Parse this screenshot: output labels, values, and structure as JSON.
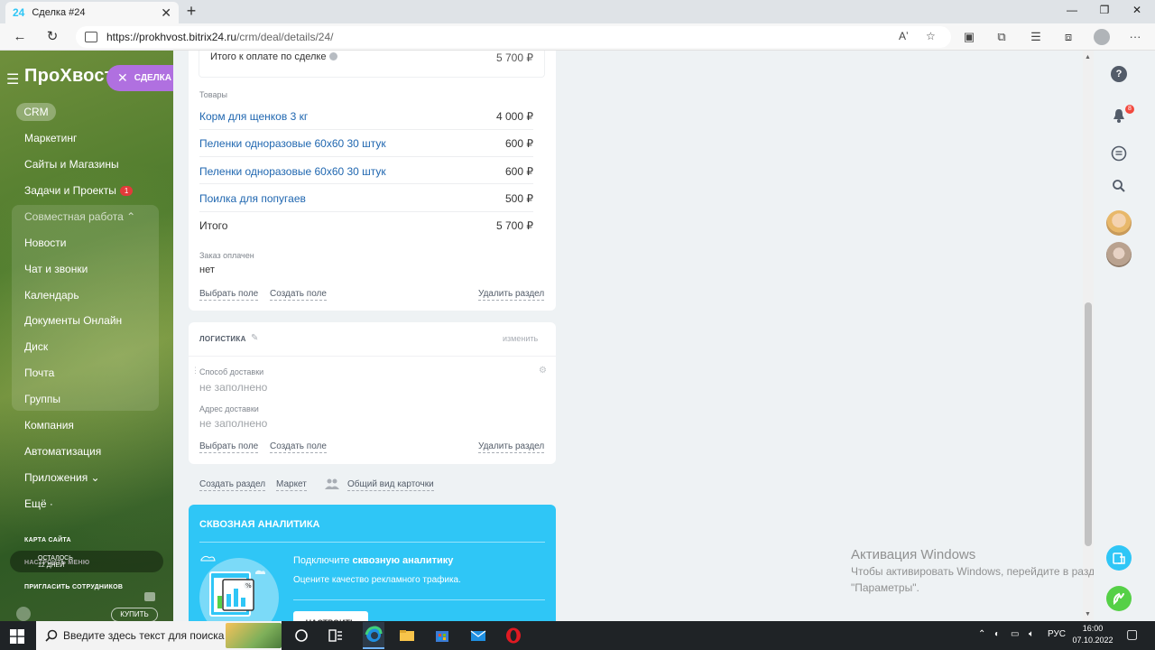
{
  "browser": {
    "tab_favicon": "24",
    "tab_title": "Сделка #24",
    "tab_close": "✕",
    "new_tab": "+",
    "url_host": "https://prokhvost.bitrix24.ru",
    "url_path": "/crm/deal/details/24/",
    "read_aloud": "Aʼ"
  },
  "sidebar": {
    "brand": "ПроХвост",
    "deal_pill": "СДЕЛКА",
    "crm": "CRM",
    "items": [
      {
        "label": "Маркетинг"
      },
      {
        "label": "Сайты и Магазины"
      },
      {
        "label": "Задачи и Проекты",
        "badge": "1"
      },
      {
        "label": "Совместная работа ⌃"
      },
      {
        "label": "Новости"
      },
      {
        "label": "Чат и звонки"
      },
      {
        "label": "Календарь"
      },
      {
        "label": "Документы Онлайн"
      },
      {
        "label": "Диск"
      },
      {
        "label": "Почта"
      },
      {
        "label": "Группы"
      },
      {
        "label": "Компания"
      },
      {
        "label": "Автоматизация"
      },
      {
        "label": "Приложения ⌄"
      },
      {
        "label": "Ещё ·"
      }
    ],
    "sitemap": "КАРТА САЙТА",
    "setup_menu": "НАСТРОИТЬ МЕНЮ",
    "invite": "ПРИГЛАСИТЬ СОТРУДНИКОВ",
    "trial_line1": "ОСТАЛОСЬ",
    "trial_line2": "12 ДНЕЙ",
    "buy": "КУПИТЬ"
  },
  "deal": {
    "total_label": "Итого к оплате по сделке",
    "total_value": "5 700 ₽",
    "goods_label": "Товары",
    "products": [
      {
        "name": "Корм для щенков 3 кг",
        "price": "4 000 ₽"
      },
      {
        "name": "Пеленки одноразовые 60х60 30 штук",
        "price": "600 ₽"
      },
      {
        "name": "Пеленки одноразовые 60х60 30 штук",
        "price": "600 ₽"
      },
      {
        "name": "Поилка для попугаев",
        "price": "500 ₽"
      }
    ],
    "sum_label": "Итого",
    "sum_value": "5 700 ₽",
    "paid_label": "Заказ оплачен",
    "paid_value": "нет",
    "choose_field": "Выбрать поле",
    "create_field": "Создать поле",
    "delete_section": "Удалить раздел"
  },
  "logistics": {
    "title": "ЛОГИСТИКА",
    "edit": "изменить",
    "delivery_label": "Способ доставки",
    "delivery_value": "не заполнено",
    "address_label": "Адрес доставки",
    "address_value": "не заполнено",
    "choose_field": "Выбрать поле",
    "create_field": "Создать поле",
    "delete_section": "Удалить раздел"
  },
  "bottom_links": {
    "create_section": "Создать раздел",
    "market": "Маркет",
    "common_view": "Общий вид карточки"
  },
  "analytics": {
    "title": "СКВОЗНАЯ АНАЛИТИКА",
    "line1_prefix": "Подключите ",
    "line1_bold": "сквозную аналитику",
    "line2": "Оцените качество рекламного трафика.",
    "button": "НАСТРОИТЬ"
  },
  "activation": {
    "title": "Активация Windows",
    "line1": "Чтобы активировать Windows, перейдите в раздел",
    "line2": "\"Параметры\"."
  },
  "right_panel": {
    "help": "?",
    "notifications_badge": "8"
  },
  "taskbar": {
    "search_placeholder": "Введите здесь текст для поиска",
    "lang": "РУС",
    "time": "16:00",
    "date": "07.10.2022"
  },
  "colors": {
    "accent": "#2fc6f6",
    "link": "#2067b0",
    "deal_pill": "#b070e0",
    "badge_red": "#e43a3a",
    "call_green": "#55d047"
  }
}
